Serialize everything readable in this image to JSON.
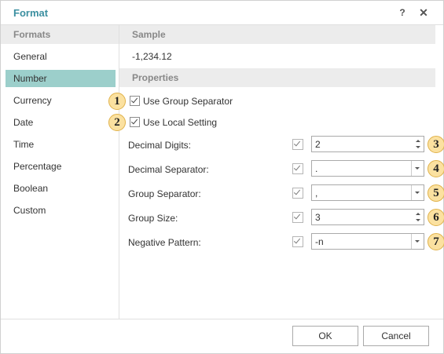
{
  "dialog": {
    "title": "Format",
    "help_label": "?",
    "close_label": "✕"
  },
  "formats": {
    "header": "Formats",
    "items": [
      "General",
      "Number",
      "Currency",
      "Date",
      "Time",
      "Percentage",
      "Boolean",
      "Custom"
    ],
    "selected": "Number"
  },
  "sample": {
    "header": "Sample",
    "value": "-1,234.12"
  },
  "properties": {
    "header": "Properties",
    "use_group_separator": {
      "label": "Use Group Separator",
      "checked": true,
      "badge": "1"
    },
    "use_local_setting": {
      "label": "Use Local Setting",
      "checked": true,
      "badge": "2"
    },
    "decimal_digits": {
      "label": "Decimal Digits:",
      "value": "2",
      "checked": true,
      "badge": "3"
    },
    "decimal_separator": {
      "label": "Decimal Separator:",
      "value": ".",
      "checked": true,
      "badge": "4"
    },
    "group_separator": {
      "label": "Group Separator:",
      "value": ",",
      "checked": true,
      "badge": "5"
    },
    "group_size": {
      "label": "Group Size:",
      "value": "3",
      "checked": true,
      "badge": "6"
    },
    "negative_pattern": {
      "label": "Negative Pattern:",
      "value": "-n",
      "checked": true,
      "badge": "7"
    }
  },
  "buttons": {
    "ok": "OK",
    "cancel": "Cancel"
  },
  "colors": {
    "title": "#3b8fa0",
    "selected_item": "#9ccfcb",
    "badge_fill": "#fbe1a0"
  }
}
